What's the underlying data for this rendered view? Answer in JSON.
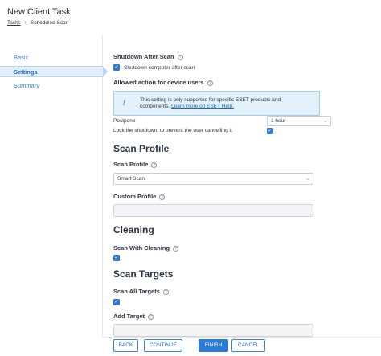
{
  "header": {
    "title": "New Client Task",
    "breadcrumb": {
      "parent": "Tasks",
      "current": "Scheduled Scan"
    }
  },
  "sidebar": {
    "items": [
      {
        "label": "Basic"
      },
      {
        "label": "Settings"
      },
      {
        "label": "Summary"
      }
    ]
  },
  "shutdown": {
    "heading": "Shutdown After Scan",
    "checkbox_label": "Shutdown computer after scan",
    "checked": true
  },
  "allowed_action": {
    "heading": "Allowed action for device users",
    "info_text": "This setting is only supported for specific ESET products and components.",
    "info_link": "Learn more on ESET Help.",
    "postpone_label": "Postpone",
    "postpone_value": "1 hour",
    "lock_label": "Lock the shutdown, to prevent the user cancelling it",
    "lock_checked": true
  },
  "scan_profile": {
    "section_title": "Scan Profile",
    "profile_label": "Scan Profile",
    "profile_value": "Smart Scan",
    "custom_label": "Custom Profile",
    "custom_value": ""
  },
  "cleaning": {
    "section_title": "Cleaning",
    "label": "Scan With Cleaning",
    "checked": true
  },
  "scan_targets": {
    "section_title": "Scan Targets",
    "all_label": "Scan All Targets",
    "all_checked": true,
    "add_label": "Add Target"
  },
  "footer": {
    "back": "BACK",
    "continue": "CONTINUE",
    "finish": "FINISH",
    "cancel": "CANCEL"
  },
  "icons": {
    "help": "question-circle-icon",
    "info": "info-icon",
    "check": "check-icon",
    "chevron": "chevron-down-icon",
    "breadcrumb_separator": "chevron-right-icon"
  },
  "colors": {
    "accent": "#2d7ad6",
    "selected_nav_bg": "#e2eefb",
    "info_bg": "#e3f1fa"
  }
}
